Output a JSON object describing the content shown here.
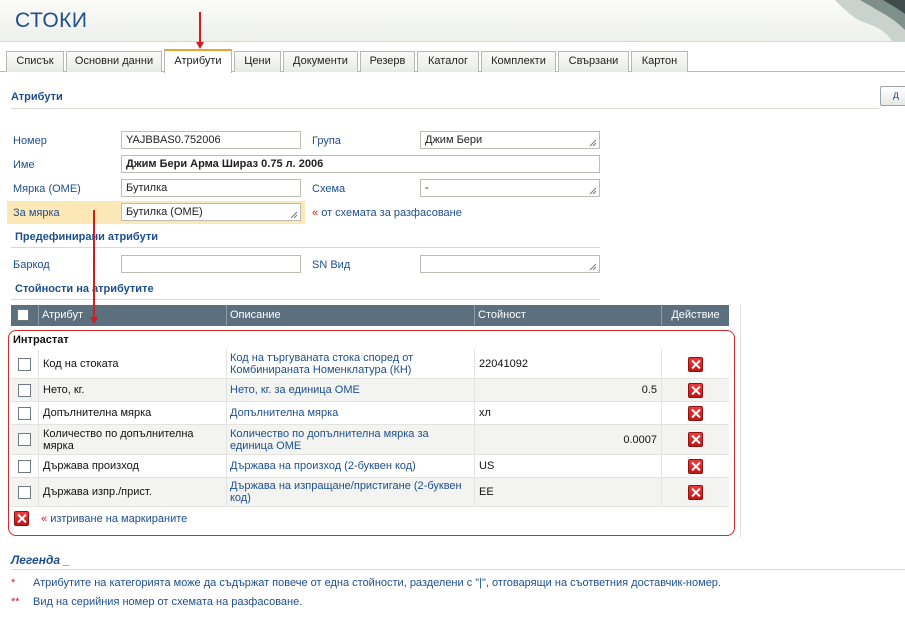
{
  "app": {
    "title": "СТОКИ"
  },
  "tabs": [
    {
      "label": "Списък"
    },
    {
      "label": "Основни данни"
    },
    {
      "label": "Атрибути",
      "active": true
    },
    {
      "label": "Цени"
    },
    {
      "label": "Документи"
    },
    {
      "label": "Резерв"
    },
    {
      "label": "Каталог"
    },
    {
      "label": "Комплекти"
    },
    {
      "label": "Свързани"
    },
    {
      "label": "Картон"
    }
  ],
  "attributes_section": {
    "title": "Атрибути",
    "corner_button_label": "д",
    "number_label": "Номер",
    "number_value": "YAJBBAS0.752006",
    "group_label": "Група",
    "group_value": "Джим Бери",
    "name_label": "Име",
    "name_value": "Джим Бери Арма Шираз 0.75 л. 2006",
    "unit_label": "Мярка (ОМЕ)",
    "unit_value": "Бутилка",
    "scheme_label": "Схема",
    "scheme_value": "-",
    "for_unit_label": "За мярка",
    "for_unit_value": "Бутилка (ОМЕ)",
    "from_scheme_link": "от схемата за разфасоване"
  },
  "predefined_section": {
    "title": "Предефинирани атрибути",
    "barcode_label": "Баркод",
    "barcode_value": "",
    "sn_label": "SN Вид",
    "sn_value": ""
  },
  "values_section": {
    "title": "Стойности на атрибутите",
    "columns": [
      "Атрибут",
      "Описание",
      "Стойност",
      "Действие"
    ],
    "group_name": "Интрастат",
    "rows": [
      {
        "attribute": "Код на стоката",
        "description": "Код на търгуваната стока според от Комбинираната Номенклатура (КН)",
        "value": "22041092",
        "align": "left"
      },
      {
        "attribute": "Нето, кг.",
        "description": "Нето, кг. за единица ОМЕ",
        "value": "0.5",
        "align": "right"
      },
      {
        "attribute": "Допълнителна мярка",
        "description": "Допълнителна мярка",
        "value": "хл",
        "align": "left"
      },
      {
        "attribute": "Количество по допълнителна мярка",
        "description": "Количество по допълнителна мярка за единица ОМЕ",
        "value": "0.0007",
        "align": "right"
      },
      {
        "attribute": "Държава произход",
        "description": "Държава на произход (2-буквен код)",
        "value": "US",
        "align": "left"
      },
      {
        "attribute": "Държава изпр./прист.",
        "description": "Държава на изпращане/пристигане (2-буквен код)",
        "value": "EE",
        "align": "left"
      }
    ],
    "delete_marked_link": "изтриване на маркираните"
  },
  "legend": {
    "title": "Легенда",
    "items": [
      {
        "marker": "*",
        "text": "Атрибутите на категорията може да съдържат повече от една стойности, разделени с \"|\", отговарящи на съответния доставчик-номер."
      },
      {
        "marker": "**",
        "text": "Вид на серийния номер от схемата на разфасоване."
      }
    ]
  },
  "colors": {
    "accent": "#1d4f8c",
    "header_grid": "#5c6f7f",
    "annotation_red": "#d21d1d",
    "highlight": "#fce7b6",
    "active_tab": "#f0a02d"
  },
  "icons": {
    "delete": "red-x-icon",
    "resize": "resize-grip-icon"
  }
}
